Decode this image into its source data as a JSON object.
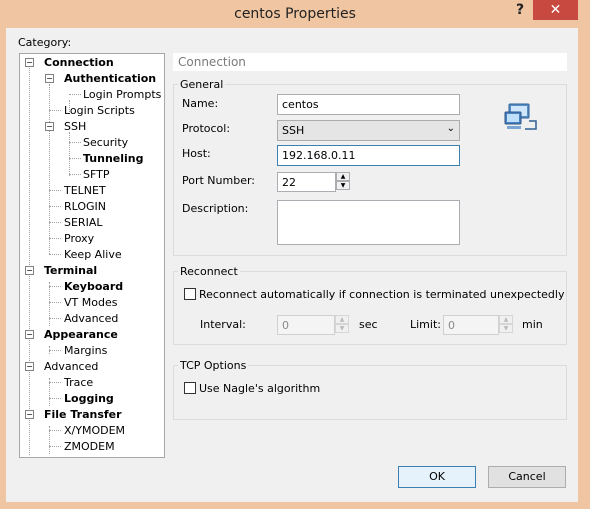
{
  "window": {
    "title": "centos Properties",
    "help": "?",
    "close": "✕"
  },
  "category_label": "Category:",
  "tree": [
    {
      "label": "Connection",
      "bold": true,
      "expander": "−"
    },
    {
      "label": "Authentication",
      "bold": true,
      "expander": "−"
    },
    {
      "label": "Login Prompts",
      "bold": false
    },
    {
      "label": "Login Scripts",
      "bold": false
    },
    {
      "label": "SSH",
      "bold": false,
      "expander": "−"
    },
    {
      "label": "Security",
      "bold": false
    },
    {
      "label": "Tunneling",
      "bold": true
    },
    {
      "label": "SFTP",
      "bold": false
    },
    {
      "label": "TELNET",
      "bold": false
    },
    {
      "label": "RLOGIN",
      "bold": false
    },
    {
      "label": "SERIAL",
      "bold": false
    },
    {
      "label": "Proxy",
      "bold": false
    },
    {
      "label": "Keep Alive",
      "bold": false
    },
    {
      "label": "Terminal",
      "bold": true,
      "expander": "−"
    },
    {
      "label": "Keyboard",
      "bold": true
    },
    {
      "label": "VT Modes",
      "bold": false
    },
    {
      "label": "Advanced",
      "bold": false
    },
    {
      "label": "Appearance",
      "bold": true,
      "expander": "−"
    },
    {
      "label": "Margins",
      "bold": false
    },
    {
      "label": "Advanced",
      "bold": false,
      "expander": "−"
    },
    {
      "label": "Trace",
      "bold": false
    },
    {
      "label": "Logging",
      "bold": true
    },
    {
      "label": "File Transfer",
      "bold": true,
      "expander": "−"
    },
    {
      "label": "X/YMODEM",
      "bold": false
    },
    {
      "label": "ZMODEM",
      "bold": false
    }
  ],
  "section_header": "Connection",
  "general": {
    "title": "General",
    "name_label": "Name:",
    "name_value": "centos",
    "protocol_label": "Protocol:",
    "protocol_value": "SSH",
    "host_label": "Host:",
    "host_value": "192.168.0.11",
    "port_label": "Port Number:",
    "port_value": "22",
    "description_label": "Description:",
    "description_value": ""
  },
  "reconnect": {
    "title": "Reconnect",
    "checkbox_label": "Reconnect automatically if connection is terminated unexpectedly",
    "checked": false,
    "interval_label": "Interval:",
    "interval_value": "0",
    "interval_unit": "sec",
    "limit_label": "Limit:",
    "limit_value": "0",
    "limit_unit": "min"
  },
  "tcp": {
    "title": "TCP Options",
    "nagle_label": "Use Nagle's algorithm",
    "checked": false
  },
  "buttons": {
    "ok": "OK",
    "cancel": "Cancel"
  },
  "colors": {
    "titlebar": "#f0c5a1",
    "close_button": "#c7493f",
    "focus_border": "#3c7fb1"
  },
  "icons": {
    "connection": "network-computer-icon"
  }
}
